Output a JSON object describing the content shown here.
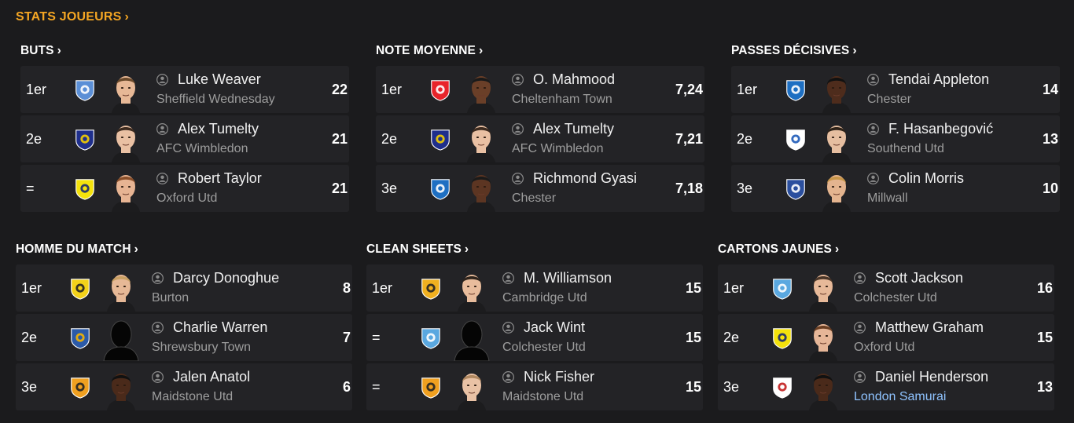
{
  "page_title": "STATS JOUEURS",
  "chevron": "›",
  "sections": [
    {
      "title": "BUTS",
      "rows": [
        {
          "rank": "1er",
          "name": "Luke Weaver",
          "club": "Sheffield Wednesday",
          "value": "22",
          "badge_color": "#5b8fd6",
          "badge_accent": "#ffffff",
          "skin": "#e7b896",
          "hair": "#6b4a2b"
        },
        {
          "rank": "2e",
          "name": "Alex Tumelty",
          "club": "AFC Wimbledon",
          "value": "21",
          "badge_color": "#1f2f8c",
          "badge_accent": "#f5d000",
          "skin": "#e9c0a3",
          "hair": "#3d2b1f"
        },
        {
          "rank": "=",
          "name": "Robert Taylor",
          "club": "Oxford Utd",
          "value": "21",
          "badge_color": "#f4e20c",
          "badge_accent": "#1a2a6e",
          "skin": "#e7b493",
          "hair": "#8a4f2a"
        }
      ]
    },
    {
      "title": "NOTE MOYENNE",
      "rows": [
        {
          "rank": "1er",
          "name": "O. Mahmood",
          "club": "Cheltenham Town",
          "value": "7,24",
          "badge_color": "#e8242a",
          "badge_accent": "#ffffff",
          "skin": "#6a3f28",
          "hair": "#1a1a1a"
        },
        {
          "rank": "2e",
          "name": "Alex Tumelty",
          "club": "AFC Wimbledon",
          "value": "7,21",
          "badge_color": "#1f2f8c",
          "badge_accent": "#f5d000",
          "skin": "#e9c0a3",
          "hair": "#3d2b1f"
        },
        {
          "rank": "3e",
          "name": "Richmond Gyasi",
          "club": "Chester",
          "value": "7,18",
          "badge_color": "#1e6fc2",
          "badge_accent": "#ffffff",
          "skin": "#5c3522",
          "hair": "#1a1a1a"
        }
      ]
    },
    {
      "title": "PASSES DÉCISIVES",
      "rows": [
        {
          "rank": "1er",
          "name": "Tendai Appleton",
          "club": "Chester",
          "value": "14",
          "badge_color": "#1e6fc2",
          "badge_accent": "#ffffff",
          "skin": "#4e2c1c",
          "hair": "#111111"
        },
        {
          "rank": "2e",
          "name": "F. Hasanbegović",
          "club": "Southend Utd",
          "value": "13",
          "badge_color": "#ffffff",
          "badge_accent": "#1d5ab8",
          "skin": "#e6bea0",
          "hair": "#2e2218"
        },
        {
          "rank": "3e",
          "name": "Colin Morris",
          "club": "Millwall",
          "value": "10",
          "badge_color": "#2b4f9e",
          "badge_accent": "#ffffff",
          "skin": "#e4b48f",
          "hair": "#c8964a"
        }
      ]
    },
    {
      "title": "HOMME DU MATCH",
      "rows": [
        {
          "rank": "1er",
          "name": "Darcy Donoghue",
          "club": "Burton",
          "value": "8",
          "badge_color": "#f3d21a",
          "badge_accent": "#222222",
          "skin": "#e6b896",
          "hair": "#c9a063"
        },
        {
          "rank": "2e",
          "name": "Charlie Warren",
          "club": "Shrewsbury Town",
          "value": "7",
          "badge_color": "#2b5aa8",
          "badge_accent": "#f5b400",
          "skin": "silhouette",
          "hair": "#000000"
        },
        {
          "rank": "3e",
          "name": "Jalen Anatol",
          "club": "Maidstone Utd",
          "value": "6",
          "badge_color": "#f0a020",
          "badge_accent": "#222222",
          "skin": "#4a2a1a",
          "hair": "#111111"
        }
      ]
    },
    {
      "title": "CLEAN SHEETS",
      "rows": [
        {
          "rank": "1er",
          "name": "M. Williamson",
          "club": "Cambridge Utd",
          "value": "15",
          "badge_color": "#f0b020",
          "badge_accent": "#222222",
          "skin": "#e8bc9c",
          "hair": "#2f241c"
        },
        {
          "rank": "=",
          "name": "Jack Wint",
          "club": "Colchester Utd",
          "value": "15",
          "badge_color": "#5aa8e0",
          "badge_accent": "#ffffff",
          "skin": "silhouette",
          "hair": "#000000"
        },
        {
          "rank": "=",
          "name": "Nick Fisher",
          "club": "Maidstone Utd",
          "value": "15",
          "badge_color": "#f0a020",
          "badge_accent": "#222222",
          "skin": "#e9c2a5",
          "hair": "#b08860"
        }
      ]
    },
    {
      "title": "CARTONS JAUNES",
      "rows": [
        {
          "rank": "1er",
          "name": "Scott Jackson",
          "club": "Colchester Utd",
          "value": "16",
          "badge_color": "#5aa8e0",
          "badge_accent": "#ffffff",
          "skin": "#e7b999",
          "hair": "#4a3628"
        },
        {
          "rank": "2e",
          "name": "Matthew Graham",
          "club": "Oxford Utd",
          "value": "15",
          "badge_color": "#f4e20c",
          "badge_accent": "#1a2a6e",
          "skin": "#e6b698",
          "hair": "#6a3e22"
        },
        {
          "rank": "3e",
          "name": "Daniel Henderson",
          "club": "London Samurai",
          "value": "13",
          "badge_color": "#ffffff",
          "badge_accent": "#c21e1e",
          "skin": "#4a2a1a",
          "hair": "#111111",
          "club_link": true
        }
      ]
    }
  ],
  "icons": {
    "player_status": "person-icon",
    "badge": "club-badge-icon"
  }
}
